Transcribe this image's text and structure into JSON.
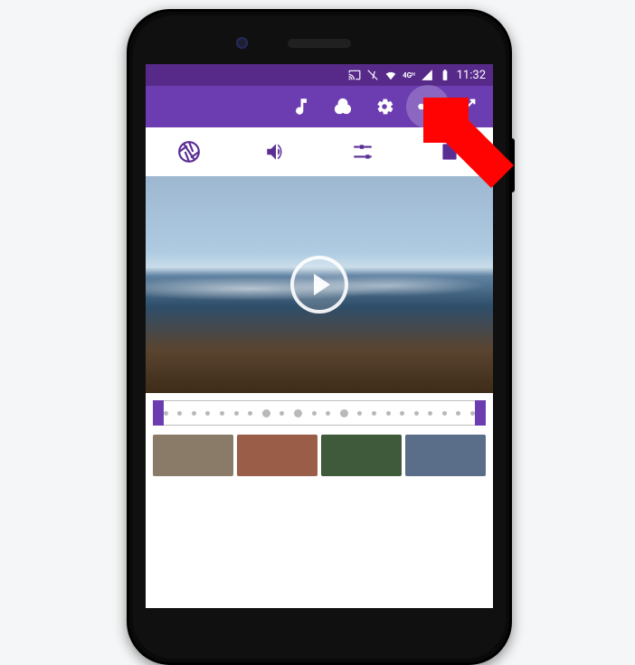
{
  "status_bar": {
    "time": "11:32",
    "icons": [
      "cast-icon",
      "vibrate-icon",
      "wifi-icon",
      "4g-lte-icon",
      "signal-icon",
      "battery-icon"
    ]
  },
  "app_bar": {
    "actions": [
      {
        "name": "music-icon"
      },
      {
        "name": "filter-venn-icon"
      },
      {
        "name": "settings-gear-icon"
      },
      {
        "name": "share-icon",
        "highlighted": true
      },
      {
        "name": "fullscreen-icon"
      }
    ]
  },
  "tabs": [
    {
      "name": "aperture-icon"
    },
    {
      "name": "volume-icon"
    },
    {
      "name": "equalizer-sliders-icon"
    },
    {
      "name": "style-icon"
    }
  ],
  "preview": {
    "has_play_button": true
  },
  "timeline": {
    "frame_dots": 22
  },
  "annotation": {
    "type": "arrow",
    "target": "share-icon",
    "color": "#ff0000"
  }
}
